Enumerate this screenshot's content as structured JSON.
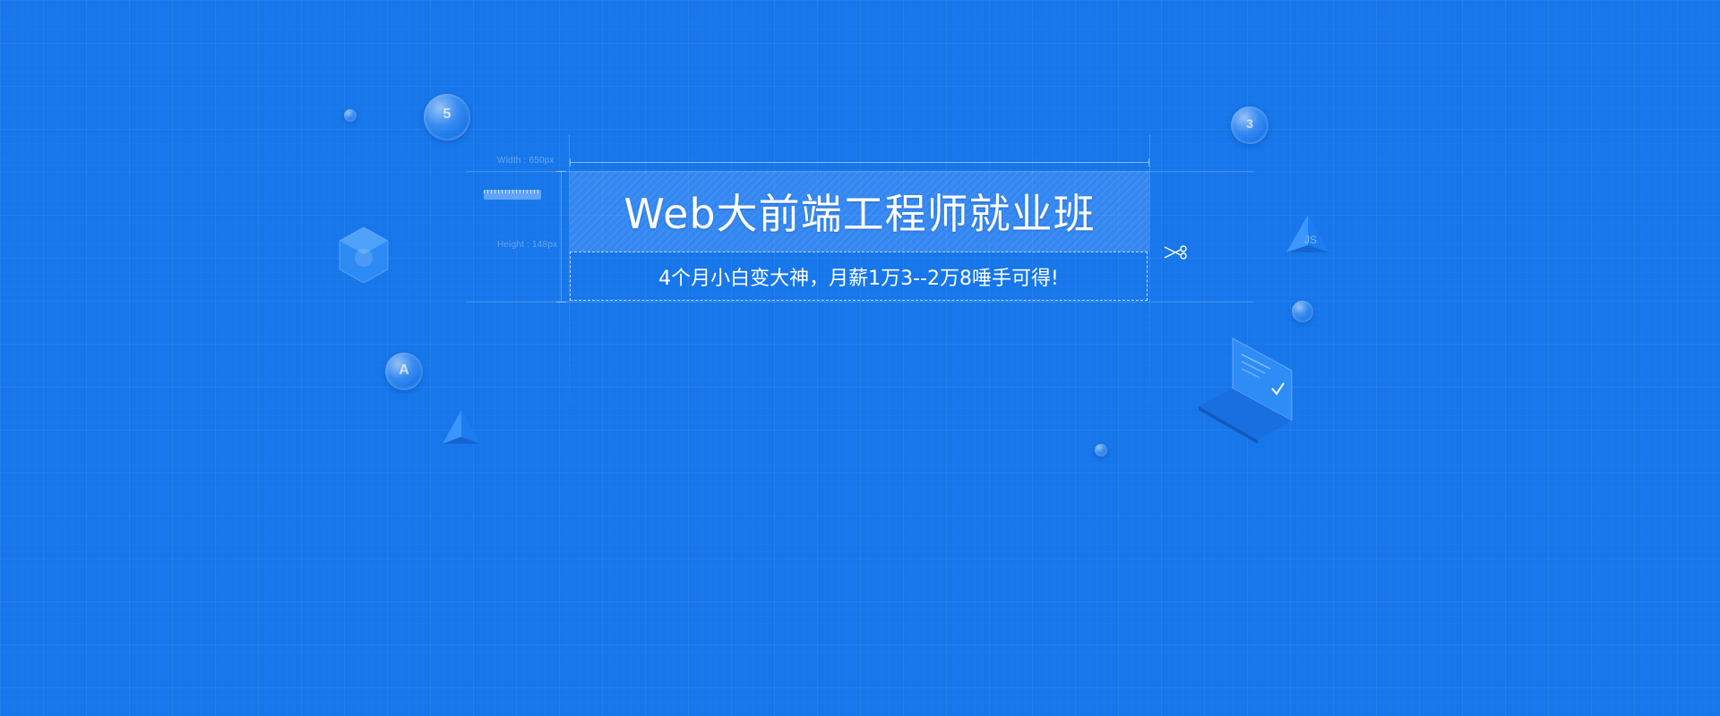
{
  "banner": {
    "title": "Web大前端工程师就业班",
    "subtitle": "4个月小白变大神，月薪1万3--2万8唾手可得!",
    "width_label": "Width : 650px",
    "height_label": "Height : 148px"
  },
  "icons": {
    "html5": "html5-icon",
    "css3": "css3-icon",
    "angular": "angular-icon",
    "nodejs": "nodejs-icon",
    "js": "js-icon",
    "scissors": "scissors-icon",
    "laptop": "laptop-icon"
  },
  "colors": {
    "background": "#1676ea",
    "title_box": "#4f92f0",
    "text": "#ffffff"
  }
}
